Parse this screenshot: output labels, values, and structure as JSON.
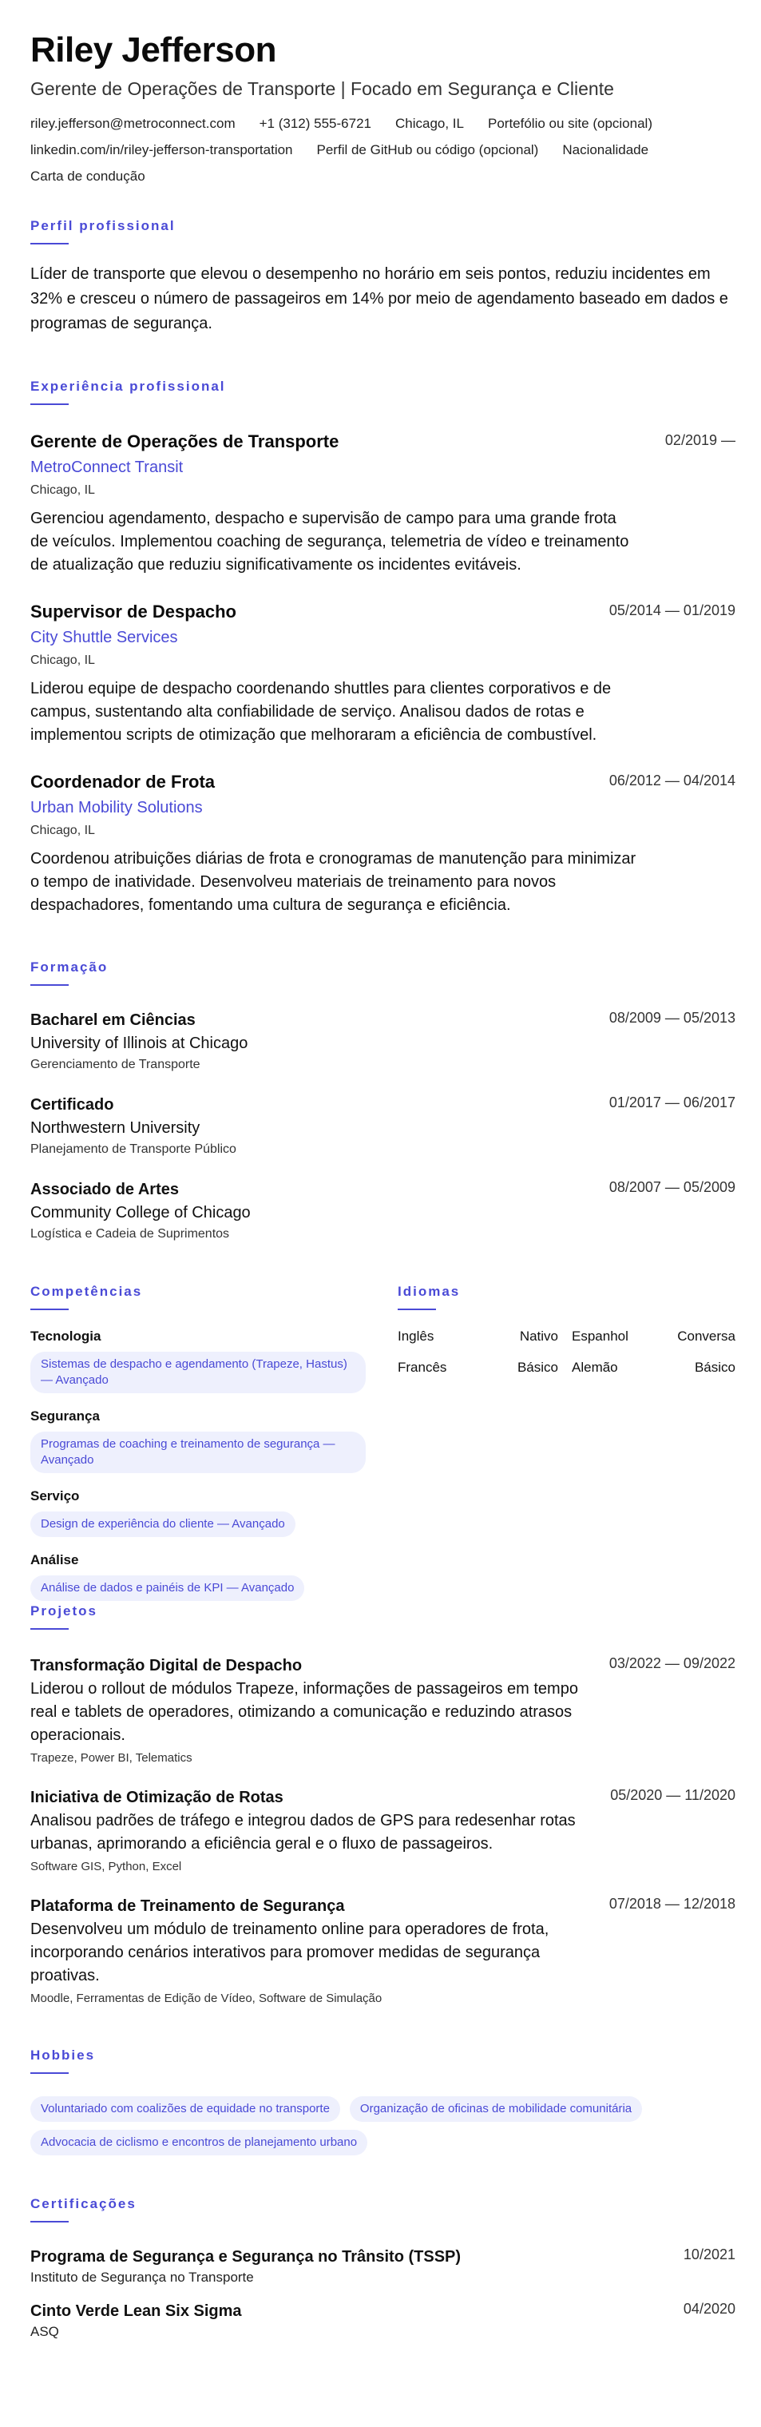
{
  "header": {
    "name": "Riley Jefferson",
    "headline": "Gerente de Operações de Transporte | Focado em Segurança e Cliente",
    "contact": [
      "riley.jefferson@metroconnect.com",
      "+1 (312) 555-6721",
      "Chicago, IL",
      "Portefólio ou site (opcional)",
      "linkedin.com/in/riley-jefferson-transportation",
      "Perfil de GitHub ou código (opcional)",
      "Nacionalidade",
      "Carta de condução"
    ]
  },
  "profile": {
    "title": "Perfil profissional",
    "text": "Líder de transporte que elevou o desempenho no horário em seis pontos, reduziu incidentes em 32% e cresceu o número de passageiros em 14% por meio de agendamento baseado em dados e programas de segurança."
  },
  "experience": {
    "title": "Experiência profissional",
    "items": [
      {
        "role": "Gerente de Operações de Transporte",
        "date": "02/2019 —",
        "company": "MetroConnect Transit",
        "location": "Chicago, IL",
        "description": "Gerenciou agendamento, despacho e supervisão de campo para uma grande frota de veículos. Implementou coaching de segurança, telemetria de vídeo e treinamento de atualização que reduziu significativamente os incidentes evitáveis."
      },
      {
        "role": "Supervisor de Despacho",
        "date": "05/2014 — 01/2019",
        "company": "City Shuttle Services",
        "location": "Chicago, IL",
        "description": "Liderou equipe de despacho coordenando shuttles para clientes corporativos e de campus, sustentando alta confiabilidade de serviço. Analisou dados de rotas e implementou scripts de otimização que melhoraram a eficiência de combustível."
      },
      {
        "role": "Coordenador de Frota",
        "date": "06/2012 — 04/2014",
        "company": "Urban Mobility Solutions",
        "location": "Chicago, IL",
        "description": "Coordenou atribuições diárias de frota e cronogramas de manutenção para minimizar o tempo de inatividade. Desenvolveu materiais de treinamento para novos despachadores, fomentando uma cultura de segurança e eficiência."
      }
    ]
  },
  "education": {
    "title": "Formação",
    "items": [
      {
        "degree": "Bacharel em Ciências",
        "date": "08/2009 — 05/2013",
        "school": "University of Illinois at Chicago",
        "field": "Gerenciamento de Transporte"
      },
      {
        "degree": "Certificado",
        "date": "01/2017 — 06/2017",
        "school": "Northwestern University",
        "field": "Planejamento de Transporte Público"
      },
      {
        "degree": "Associado de Artes",
        "date": "08/2007 — 05/2009",
        "school": "Community College of Chicago",
        "field": "Logística e Cadeia de Suprimentos"
      }
    ]
  },
  "skills": {
    "title": "Competências",
    "groups": [
      {
        "name": "Tecnologia",
        "chips": [
          "Sistemas de despacho e agendamento (Trapeze, Hastus) — Avançado"
        ]
      },
      {
        "name": "Segurança",
        "chips": [
          "Programas de coaching e treinamento de segurança — Avançado"
        ]
      },
      {
        "name": "Serviço",
        "chips": [
          "Design de experiência do cliente — Avançado"
        ]
      },
      {
        "name": "Análise",
        "chips": [
          "Análise de dados e painéis de KPI — Avançado"
        ]
      }
    ]
  },
  "languages": {
    "title": "Idiomas",
    "items": [
      {
        "name": "Inglês",
        "level": "Nativo"
      },
      {
        "name": "Espanhol",
        "level": "Conversa"
      },
      {
        "name": "Francês",
        "level": "Básico"
      },
      {
        "name": "Alemão",
        "level": "Básico"
      }
    ]
  },
  "projects": {
    "title": "Projetos",
    "items": [
      {
        "name": "Transformação Digital de Despacho",
        "date": "03/2022 — 09/2022",
        "description": "Liderou o rollout de módulos Trapeze, informações de passageiros em tempo real e tablets de operadores, otimizando a comunicação e reduzindo atrasos operacionais.",
        "tech": "Trapeze, Power BI, Telematics"
      },
      {
        "name": "Iniciativa de Otimização de Rotas",
        "date": "05/2020 — 11/2020",
        "description": "Analisou padrões de tráfego e integrou dados de GPS para redesenhar rotas urbanas, aprimorando a eficiência geral e o fluxo de passageiros.",
        "tech": "Software GIS, Python, Excel"
      },
      {
        "name": "Plataforma de Treinamento de Segurança",
        "date": "07/2018 — 12/2018",
        "description": "Desenvolveu um módulo de treinamento online para operadores de frota, incorporando cenários interativos para promover medidas de segurança proativas.",
        "tech": "Moodle, Ferramentas de Edição de Vídeo, Software de Simulação"
      }
    ]
  },
  "hobbies": {
    "title": "Hobbies",
    "items": [
      "Voluntariado com coalizões de equidade no transporte",
      "Organização de oficinas de mobilidade comunitária",
      "Advocacia de ciclismo e encontros de planejamento urbano"
    ]
  },
  "certifications": {
    "title": "Certificações",
    "items": [
      {
        "name": "Programa de Segurança e Segurança no Trânsito (TSSP)",
        "date": "10/2021",
        "issuer": "Instituto de Segurança no Transporte"
      },
      {
        "name": "Cinto Verde Lean Six Sigma",
        "date": "04/2020",
        "issuer": "ASQ"
      }
    ]
  },
  "colors": {
    "accent": "#4a4ad6",
    "chip_bg": "#eef0fd",
    "text": "#111111"
  }
}
